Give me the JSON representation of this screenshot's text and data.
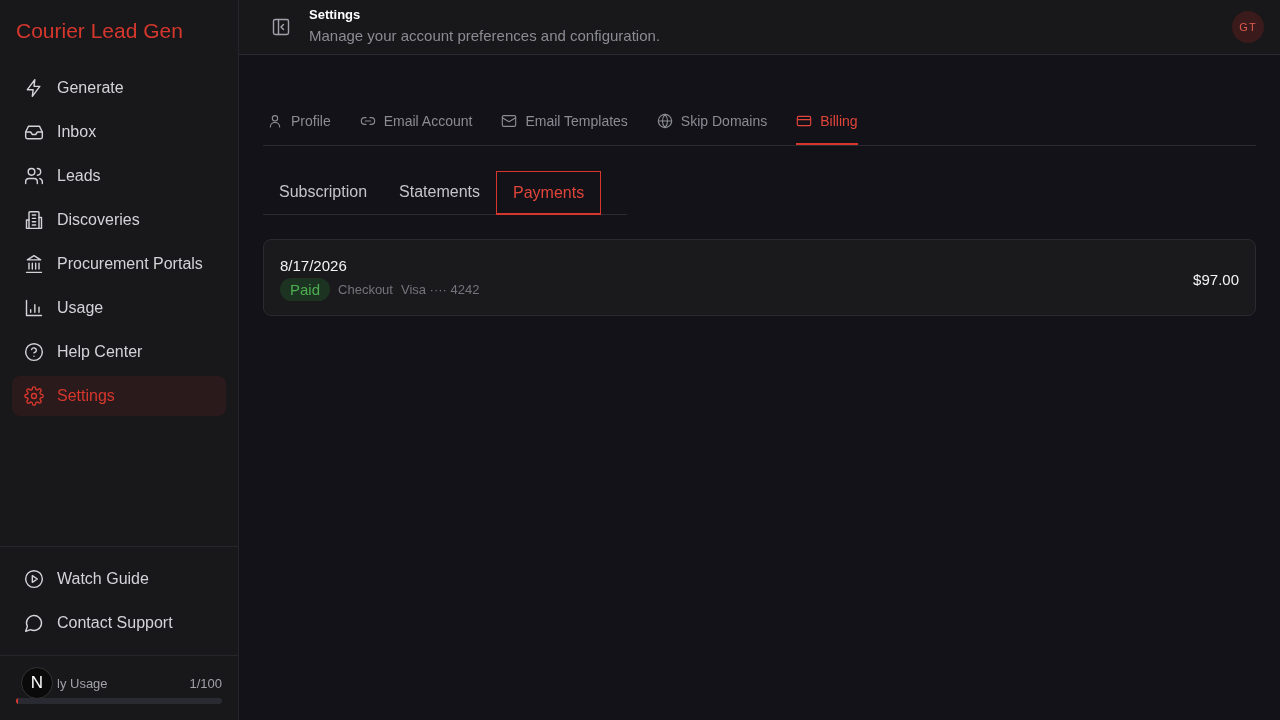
{
  "app": {
    "title": "Courier Lead Gen"
  },
  "sidebar": {
    "items": [
      {
        "label": "Generate",
        "selected": false
      },
      {
        "label": "Inbox",
        "selected": false
      },
      {
        "label": "Leads",
        "selected": false
      },
      {
        "label": "Discoveries",
        "selected": false
      },
      {
        "label": "Procurement Portals",
        "selected": false
      },
      {
        "label": "Usage",
        "selected": false
      },
      {
        "label": "Help Center",
        "selected": false
      },
      {
        "label": "Settings",
        "selected": true
      }
    ],
    "footer_items": [
      {
        "label": "Watch Guide"
      },
      {
        "label": "Contact Support"
      }
    ],
    "usage": {
      "label": "ly Usage",
      "reading": "1/100",
      "level": 0.01
    },
    "badge": "N"
  },
  "header": {
    "title": "Settings",
    "subtitle": "Manage your account preferences and configuration.",
    "avatar": "GT"
  },
  "tabs": [
    {
      "label": "Profile",
      "selected": false
    },
    {
      "label": "Email Account",
      "selected": false
    },
    {
      "label": "Email Templates",
      "selected": false
    },
    {
      "label": "Skip Domains",
      "selected": false
    },
    {
      "label": "Billing",
      "selected": true
    }
  ],
  "subtabs": [
    {
      "label": "Subscription",
      "selected": false
    },
    {
      "label": "Statements",
      "selected": false
    },
    {
      "label": "Payments",
      "selected": true
    }
  ],
  "payments": [
    {
      "date": "8/17/2026",
      "status": "Paid",
      "source": "Checkout",
      "card": "Visa ···· 4242",
      "amount": "$97.00"
    }
  ]
}
